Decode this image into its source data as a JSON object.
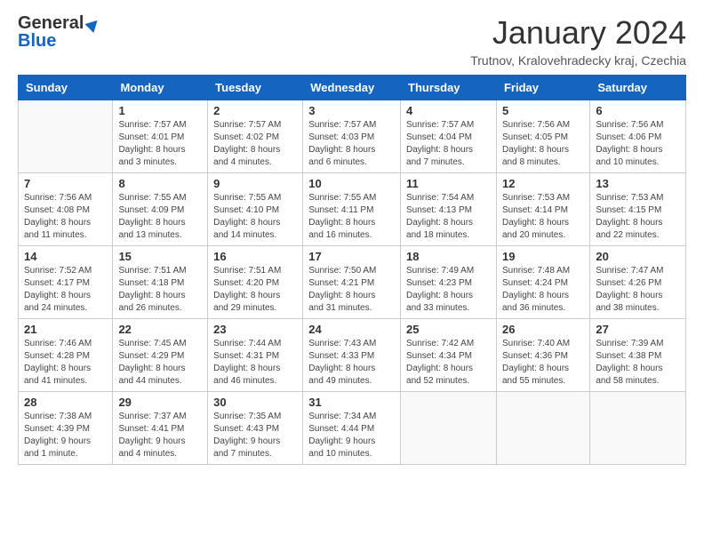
{
  "header": {
    "logo_line1": "General",
    "logo_line2": "Blue",
    "main_title": "January 2024",
    "subtitle": "Trutnov, Kralovehradecky kraj, Czechia"
  },
  "calendar": {
    "days_of_week": [
      "Sunday",
      "Monday",
      "Tuesday",
      "Wednesday",
      "Thursday",
      "Friday",
      "Saturday"
    ],
    "weeks": [
      [
        {
          "day": "",
          "info": ""
        },
        {
          "day": "1",
          "info": "Sunrise: 7:57 AM\nSunset: 4:01 PM\nDaylight: 8 hours\nand 3 minutes."
        },
        {
          "day": "2",
          "info": "Sunrise: 7:57 AM\nSunset: 4:02 PM\nDaylight: 8 hours\nand 4 minutes."
        },
        {
          "day": "3",
          "info": "Sunrise: 7:57 AM\nSunset: 4:03 PM\nDaylight: 8 hours\nand 6 minutes."
        },
        {
          "day": "4",
          "info": "Sunrise: 7:57 AM\nSunset: 4:04 PM\nDaylight: 8 hours\nand 7 minutes."
        },
        {
          "day": "5",
          "info": "Sunrise: 7:56 AM\nSunset: 4:05 PM\nDaylight: 8 hours\nand 8 minutes."
        },
        {
          "day": "6",
          "info": "Sunrise: 7:56 AM\nSunset: 4:06 PM\nDaylight: 8 hours\nand 10 minutes."
        }
      ],
      [
        {
          "day": "7",
          "info": "Sunrise: 7:56 AM\nSunset: 4:08 PM\nDaylight: 8 hours\nand 11 minutes."
        },
        {
          "day": "8",
          "info": "Sunrise: 7:55 AM\nSunset: 4:09 PM\nDaylight: 8 hours\nand 13 minutes."
        },
        {
          "day": "9",
          "info": "Sunrise: 7:55 AM\nSunset: 4:10 PM\nDaylight: 8 hours\nand 14 minutes."
        },
        {
          "day": "10",
          "info": "Sunrise: 7:55 AM\nSunset: 4:11 PM\nDaylight: 8 hours\nand 16 minutes."
        },
        {
          "day": "11",
          "info": "Sunrise: 7:54 AM\nSunset: 4:13 PM\nDaylight: 8 hours\nand 18 minutes."
        },
        {
          "day": "12",
          "info": "Sunrise: 7:53 AM\nSunset: 4:14 PM\nDaylight: 8 hours\nand 20 minutes."
        },
        {
          "day": "13",
          "info": "Sunrise: 7:53 AM\nSunset: 4:15 PM\nDaylight: 8 hours\nand 22 minutes."
        }
      ],
      [
        {
          "day": "14",
          "info": "Sunrise: 7:52 AM\nSunset: 4:17 PM\nDaylight: 8 hours\nand 24 minutes."
        },
        {
          "day": "15",
          "info": "Sunrise: 7:51 AM\nSunset: 4:18 PM\nDaylight: 8 hours\nand 26 minutes."
        },
        {
          "day": "16",
          "info": "Sunrise: 7:51 AM\nSunset: 4:20 PM\nDaylight: 8 hours\nand 29 minutes."
        },
        {
          "day": "17",
          "info": "Sunrise: 7:50 AM\nSunset: 4:21 PM\nDaylight: 8 hours\nand 31 minutes."
        },
        {
          "day": "18",
          "info": "Sunrise: 7:49 AM\nSunset: 4:23 PM\nDaylight: 8 hours\nand 33 minutes."
        },
        {
          "day": "19",
          "info": "Sunrise: 7:48 AM\nSunset: 4:24 PM\nDaylight: 8 hours\nand 36 minutes."
        },
        {
          "day": "20",
          "info": "Sunrise: 7:47 AM\nSunset: 4:26 PM\nDaylight: 8 hours\nand 38 minutes."
        }
      ],
      [
        {
          "day": "21",
          "info": "Sunrise: 7:46 AM\nSunset: 4:28 PM\nDaylight: 8 hours\nand 41 minutes."
        },
        {
          "day": "22",
          "info": "Sunrise: 7:45 AM\nSunset: 4:29 PM\nDaylight: 8 hours\nand 44 minutes."
        },
        {
          "day": "23",
          "info": "Sunrise: 7:44 AM\nSunset: 4:31 PM\nDaylight: 8 hours\nand 46 minutes."
        },
        {
          "day": "24",
          "info": "Sunrise: 7:43 AM\nSunset: 4:33 PM\nDaylight: 8 hours\nand 49 minutes."
        },
        {
          "day": "25",
          "info": "Sunrise: 7:42 AM\nSunset: 4:34 PM\nDaylight: 8 hours\nand 52 minutes."
        },
        {
          "day": "26",
          "info": "Sunrise: 7:40 AM\nSunset: 4:36 PM\nDaylight: 8 hours\nand 55 minutes."
        },
        {
          "day": "27",
          "info": "Sunrise: 7:39 AM\nSunset: 4:38 PM\nDaylight: 8 hours\nand 58 minutes."
        }
      ],
      [
        {
          "day": "28",
          "info": "Sunrise: 7:38 AM\nSunset: 4:39 PM\nDaylight: 9 hours\nand 1 minute."
        },
        {
          "day": "29",
          "info": "Sunrise: 7:37 AM\nSunset: 4:41 PM\nDaylight: 9 hours\nand 4 minutes."
        },
        {
          "day": "30",
          "info": "Sunrise: 7:35 AM\nSunset: 4:43 PM\nDaylight: 9 hours\nand 7 minutes."
        },
        {
          "day": "31",
          "info": "Sunrise: 7:34 AM\nSunset: 4:44 PM\nDaylight: 9 hours\nand 10 minutes."
        },
        {
          "day": "",
          "info": ""
        },
        {
          "day": "",
          "info": ""
        },
        {
          "day": "",
          "info": ""
        }
      ]
    ]
  }
}
